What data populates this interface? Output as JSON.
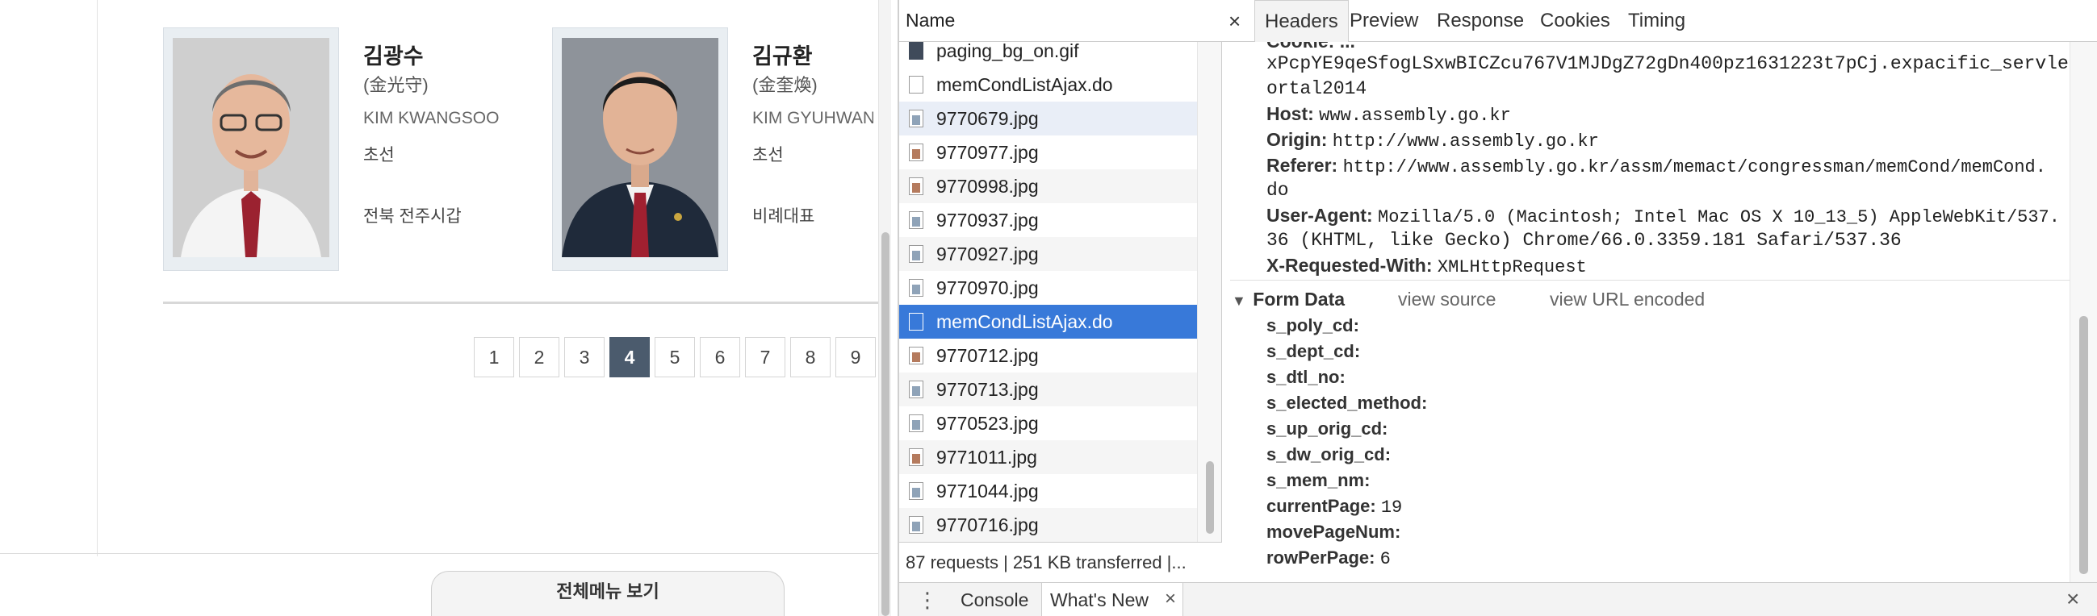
{
  "page": {
    "members": [
      {
        "name": "김광수",
        "hanja": "(金光守)",
        "english": "KIM KWANGSOO",
        "term": "초선",
        "district": "전북 전주시갑"
      },
      {
        "name": "김규환",
        "hanja": "(金奎煥)",
        "english": "KIM GYUHWAN",
        "term": "초선",
        "district": "비례대표"
      }
    ],
    "pagination": [
      "1",
      "2",
      "3",
      "4",
      "5",
      "6",
      "7",
      "8",
      "9"
    ],
    "current_page": "4",
    "full_menu_label": "전체메뉴 보기"
  },
  "devtools": {
    "name_header": "Name",
    "requests": [
      {
        "name": "paging_bg_on.gif",
        "icon": "gif-icon"
      },
      {
        "name": "memCondListAjax.do",
        "icon": "document-icon"
      },
      {
        "name": "9770679.jpg",
        "icon": "image-icon"
      },
      {
        "name": "9770977.jpg",
        "icon": "image-icon"
      },
      {
        "name": "9770998.jpg",
        "icon": "image-icon"
      },
      {
        "name": "9770937.jpg",
        "icon": "image-icon"
      },
      {
        "name": "9770927.jpg",
        "icon": "image-icon"
      },
      {
        "name": "9770970.jpg",
        "icon": "image-icon"
      },
      {
        "name": "memCondListAjax.do",
        "icon": "document-icon"
      },
      {
        "name": "9770712.jpg",
        "icon": "image-icon"
      },
      {
        "name": "9770713.jpg",
        "icon": "image-icon"
      },
      {
        "name": "9770523.jpg",
        "icon": "image-icon"
      },
      {
        "name": "9771011.jpg",
        "icon": "image-icon"
      },
      {
        "name": "9771044.jpg",
        "icon": "image-icon"
      },
      {
        "name": "9770716.jpg",
        "icon": "image-icon"
      }
    ],
    "status": "87 requests | 251 KB transferred |...",
    "tabs": {
      "close": "×",
      "headers": "Headers",
      "preview": "Preview",
      "response": "Response",
      "cookies": "Cookies",
      "timing": "Timing"
    },
    "headers": {
      "cookie_partial": "Cookie: ...",
      "cookie_line2": "xPcpYE9qeSfogLSxwBICZcu767V1MJDgZ72gDn400pz1631223t7pCj.expacific_servlet_p",
      "cookie_line3": "ortal2014",
      "host_key": "Host:",
      "host_val": "www.assembly.go.kr",
      "origin_key": "Origin:",
      "origin_val": "http://www.assembly.go.kr",
      "referer_key": "Referer:",
      "referer_val": "http://www.assembly.go.kr/assm/memact/congressman/memCond/memCond.",
      "referer_val2": "do",
      "ua_key": "User-Agent:",
      "ua_val": "Mozilla/5.0 (Macintosh; Intel Mac OS X 10_13_5) AppleWebKit/537.",
      "ua_val2": "36 (KHTML, like Gecko) Chrome/66.0.3359.181 Safari/537.36",
      "xrw_key": "X-Requested-With:",
      "xrw_val": "XMLHttpRequest"
    },
    "form_data": {
      "title": "Form Data",
      "view_source": "view source",
      "view_url_encoded": "view URL encoded",
      "fields": [
        {
          "key": "s_poly_cd:",
          "value": ""
        },
        {
          "key": "s_dept_cd:",
          "value": ""
        },
        {
          "key": "s_dtl_no:",
          "value": ""
        },
        {
          "key": "s_elected_method:",
          "value": ""
        },
        {
          "key": "s_up_orig_cd:",
          "value": ""
        },
        {
          "key": "s_dw_orig_cd:",
          "value": ""
        },
        {
          "key": "s_mem_nm:",
          "value": ""
        },
        {
          "key": "currentPage:",
          "value": "19"
        },
        {
          "key": "movePageNum:",
          "value": ""
        },
        {
          "key": "rowPerPage:",
          "value": "6"
        }
      ]
    },
    "drawer": {
      "menu": "⋮",
      "console": "Console",
      "whats_new": "What's New",
      "tab_close": "×",
      "close": "×"
    }
  }
}
